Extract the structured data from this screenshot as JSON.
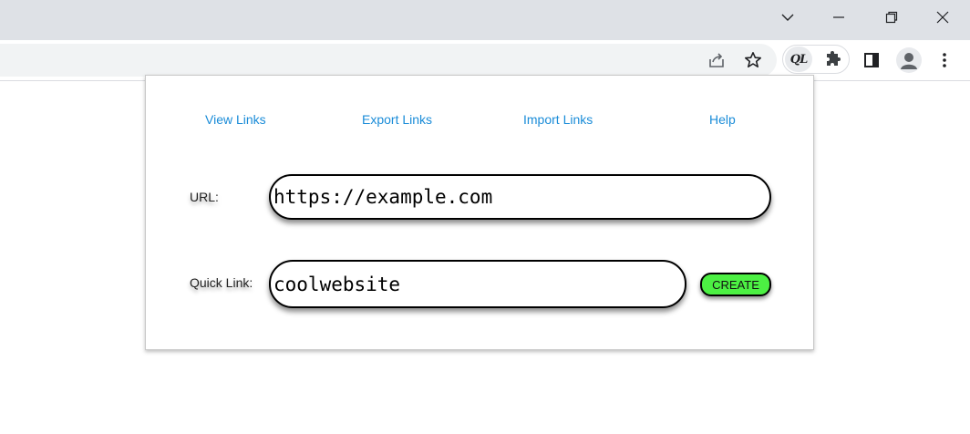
{
  "browser": {
    "window_controls": [
      "chevron-down-icon",
      "minimize-icon",
      "restore-icon",
      "close-icon"
    ],
    "toolbar_icons": [
      "share-icon",
      "bookmark-star-icon",
      "quick-links-extension-icon",
      "puzzle-extensions-icon",
      "side-panel-icon",
      "profile-avatar-icon",
      "more-menu-icon"
    ],
    "extension_badge": "QL"
  },
  "popup": {
    "nav": {
      "view": "View Links",
      "export": "Export Links",
      "import": "Import Links",
      "help": "Help"
    },
    "url_label": "URL:",
    "url_value": "https://example.com",
    "quick_link_label": "Quick Link:",
    "quick_link_value": "coolwebsite",
    "create_label": "CREATE"
  },
  "colors": {
    "link": "#1a8cd8",
    "create_button": "#4cf043",
    "title_bar": "#dee1e6",
    "omnibox": "#f1f3f4"
  }
}
